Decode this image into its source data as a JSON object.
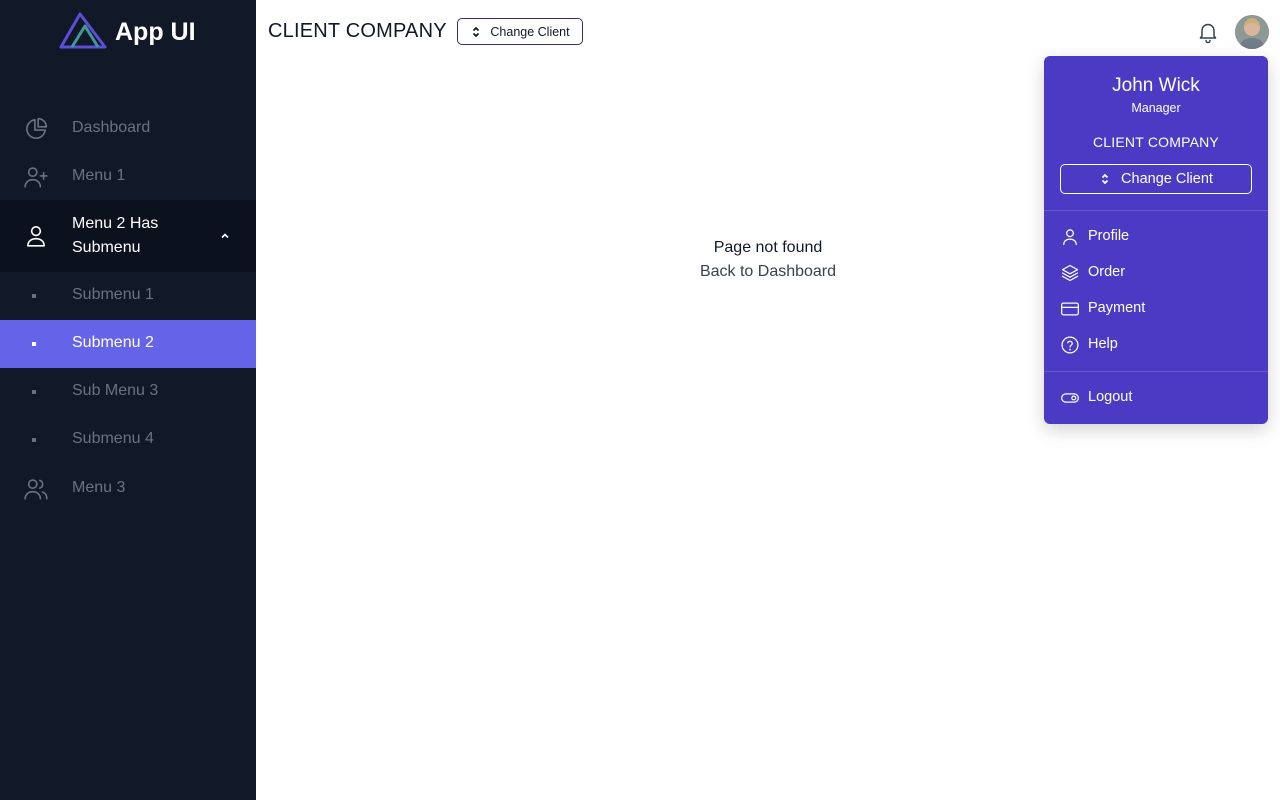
{
  "app": {
    "name": "App UI",
    "logo_icon": "triangle-logo"
  },
  "sidebar": {
    "items": [
      {
        "label": "Dashboard",
        "icon": "pie-chart-icon"
      },
      {
        "label": "Menu 1",
        "icon": "user-plus-icon"
      },
      {
        "label": "Menu 2 Has Submenu",
        "icon": "user-icon",
        "expanded": true,
        "submenu": [
          {
            "label": "Submenu 1"
          },
          {
            "label": "Submenu 2",
            "active": true
          },
          {
            "label": "Sub Menu 3"
          },
          {
            "label": "Submenu 4"
          }
        ]
      },
      {
        "label": "Menu 3",
        "icon": "users-icon"
      }
    ]
  },
  "header": {
    "company": "CLIENT COMPANY",
    "change_client_label": "Change Client"
  },
  "main": {
    "message": "Page not found",
    "back_link": "Back to Dashboard"
  },
  "user_menu": {
    "name": "John Wick",
    "role": "Manager",
    "company": "CLIENT COMPANY",
    "change_client_label": "Change Client",
    "items": [
      {
        "label": "Profile",
        "icon": "user-icon"
      },
      {
        "label": "Order",
        "icon": "layers-icon"
      },
      {
        "label": "Payment",
        "icon": "credit-card-icon"
      },
      {
        "label": "Help",
        "icon": "help-circle-icon"
      }
    ],
    "logout_label": "Logout"
  },
  "colors": {
    "sidebar_bg": "#111827",
    "active_item": "#6563e7",
    "dropdown_bg": "#4a3ac4"
  }
}
